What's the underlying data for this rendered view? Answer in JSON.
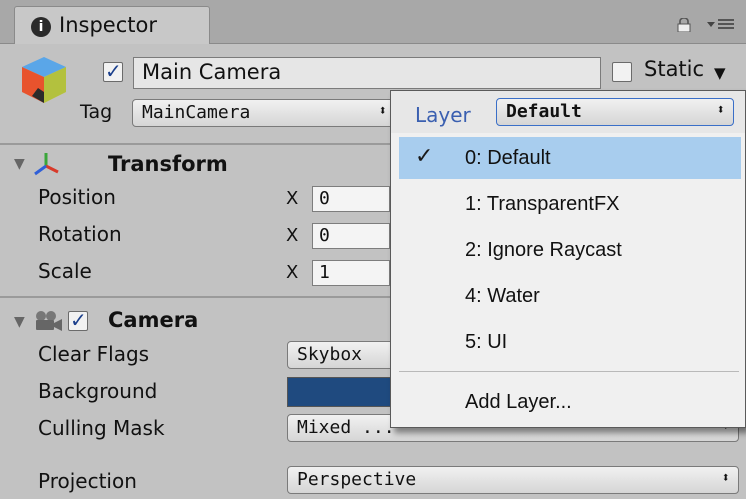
{
  "tab": {
    "icon_glyph": "i",
    "label": "Inspector"
  },
  "object": {
    "enabled": true,
    "name": "Main Camera",
    "static_label": "Static",
    "tag_label": "Tag",
    "tag_value": "MainCamera"
  },
  "layer_menu": {
    "label": "Layer",
    "current": "Default",
    "items": [
      {
        "label": "0: Default",
        "checked": true
      },
      {
        "label": "1: TransparentFX",
        "checked": false
      },
      {
        "label": "2: Ignore Raycast",
        "checked": false
      },
      {
        "label": "4: Water",
        "checked": false
      },
      {
        "label": "5: UI",
        "checked": false
      }
    ],
    "add_label": "Add Layer..."
  },
  "transform": {
    "title": "Transform",
    "rows": [
      {
        "label": "Position",
        "axis": "X",
        "value": "0"
      },
      {
        "label": "Rotation",
        "axis": "X",
        "value": "0"
      },
      {
        "label": "Scale",
        "axis": "X",
        "value": "1"
      }
    ]
  },
  "camera": {
    "title": "Camera",
    "enabled": true,
    "clear_flags_label": "Clear Flags",
    "clear_flags_value": "Skybox",
    "background_label": "Background",
    "background_color": "#1f4a7f",
    "culling_mask_label": "Culling Mask",
    "culling_mask_value": "Mixed ...",
    "projection_label": "Projection",
    "projection_value": "Perspective"
  },
  "colors": {
    "accent_blue": "#3a5fb0",
    "selection": "#a8cdee"
  }
}
